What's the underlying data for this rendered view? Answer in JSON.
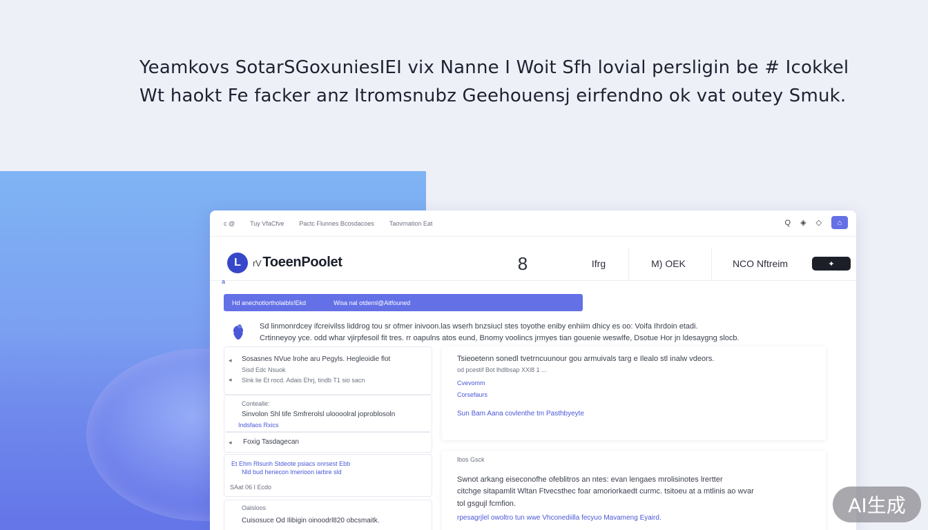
{
  "hero": {
    "line1": "Yeamkovs SotarSGoxuniesIEI vix Nanne I Woit Sfh lovial persligin be # Icokkel",
    "line2": "Wt haokt Fe facker anz Itromsnubz Geehouensj eirfendno ok vat outey Smuk."
  },
  "window": {
    "topbar": {
      "left_items": [
        "c @",
        "Tuy VfaCfve",
        "Pactc Flunnes Bcosdacoes",
        "Taovrnation Eat"
      ],
      "right_icons": [
        "search-icon",
        "apps-icon",
        "help-icon",
        "notification-icon"
      ],
      "right_glyphs": [
        "Q",
        "◈",
        "◇",
        "⌂"
      ]
    },
    "navbar": {
      "logo_letter": "L",
      "brand_prefix": "rV",
      "brand": "ToeenPoolet",
      "items": [
        "8",
        "Ifrg",
        "M) OEK",
        "NCO Nftreim"
      ],
      "pill": "✦"
    },
    "small_mark": "a",
    "banner": {
      "left": "Hd anechotlortholaibls!Ekd",
      "right": "Wisa nal otdeml@Aitfouned"
    },
    "intro": {
      "line1": "Sd linmonrdcey ifcreivilss liddrog tou sr ofmer inivoon.las wserh bnzsiucl stes toyothe eniby enhiim dhicy es oo: Voifa Ihrdoin etadi.",
      "line2": "Crtinneyoy yce. odd whar vjirpfesoil fit tres. rr oapulns atos eund, Bnomy voolincs jrmyes tian gouenie weswlfe, Dsotue Hor jn ldesaygng slocb."
    },
    "left_cards": [
      {
        "title": "Sosasnes NVue lrohe aru Pegyls. Hegleoidie flot",
        "sub": "Sisd Edc Nsuok",
        "sub2": "Slnk lie Et rocd. Adais Ehrj, tindb T1 sio sacn"
      },
      {
        "title": "Contealle:",
        "sub": "Sinvolon Shl tife Smfrerolsl uloooolral joproblosoln",
        "sub2": "Indsfaos Rxics"
      },
      {
        "title": "Foxig Tasdagecan",
        "sub": "",
        "sub2": ""
      },
      {
        "title": "Et Ehm Rlsunh Stdeote psiacs onrsest Ebb",
        "sub": "Nld bud henecon lmerioon iarbre sld",
        "sub2": "SAat 06 I Ecdo"
      },
      {
        "title": "Oalsloos",
        "sub": "Cuisosuce Od Ilibigin oinoodrl820 obcsmaitk.",
        "sub2": ""
      }
    ],
    "right_cards": [
      {
        "line1": "Tsieoetenn sonedl tvetrncuunour gou armuivals targ e Ilealo stl inalw vdeors.",
        "line2": "od pcestif Bot lhdlbsap XXl8 1 ...",
        "link1": "Cvevomm",
        "link2": "Corsefaurs",
        "link3": "Sun Bam Aana covlenthe tm Pasthbyeyte"
      },
      {
        "tag": "lbos Gsck",
        "line1": "Swnot arkang eiseconofhe ofeblitros an ntes: evan lengaes mrolisinotes lrertter",
        "line2": "citchge sitapamlit Wltan Ftvecsthec foar amoriorkaedt curmc. tsitoeu at a mtlinis ao wvar",
        "line3": "tol gsgujl fcmfion.",
        "line4": "rpesagrjlel owoltro tun wwe Vhconediilla fecyuo Mavameng Eyaird."
      }
    ]
  },
  "watermark": "AI生成"
}
